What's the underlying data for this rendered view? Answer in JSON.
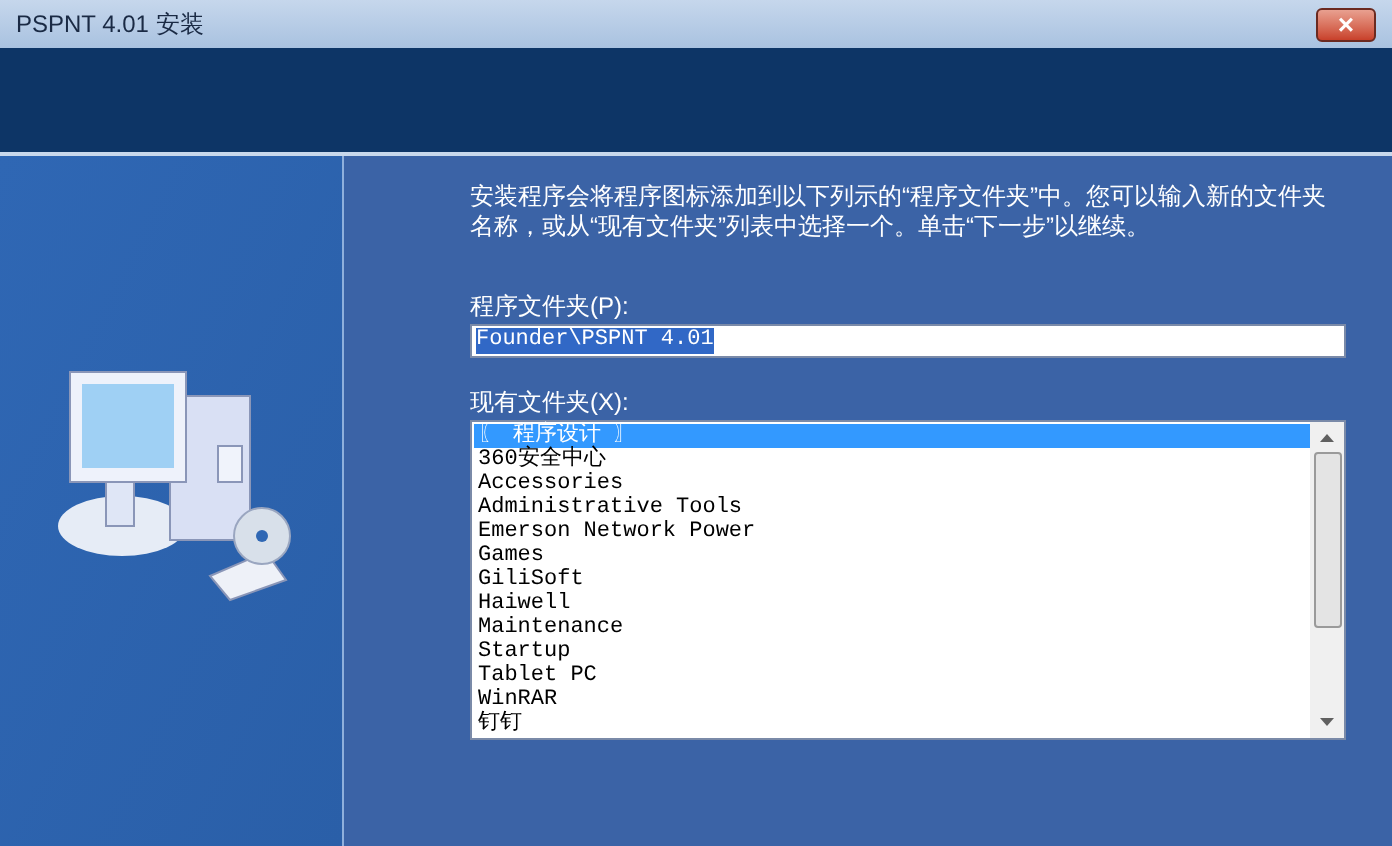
{
  "window": {
    "title": "PSPNT 4.01 安装",
    "close_label": "×"
  },
  "instructions": "安装程序会将程序图标添加到以下列示的“程序文件夹”中。您可以输入新的文件夹名称，或从“现有文件夹”列表中选择一个。单击“下一步”以继续。",
  "program_folder": {
    "label": "程序文件夹(P):",
    "value": "Founder\\PSPNT 4.01"
  },
  "existing_folders": {
    "label": "现有文件夹(X):",
    "items": [
      {
        "text": "〖 程序设计 〗",
        "selected": true
      },
      {
        "text": "360安全中心",
        "selected": false
      },
      {
        "text": "Accessories",
        "selected": false
      },
      {
        "text": "Administrative Tools",
        "selected": false
      },
      {
        "text": "Emerson Network Power",
        "selected": false
      },
      {
        "text": "Games",
        "selected": false
      },
      {
        "text": "GiliSoft",
        "selected": false
      },
      {
        "text": "Haiwell",
        "selected": false
      },
      {
        "text": "Maintenance",
        "selected": false
      },
      {
        "text": "Startup",
        "selected": false
      },
      {
        "text": "Tablet PC",
        "selected": false
      },
      {
        "text": "WinRAR",
        "selected": false
      },
      {
        "text": "钉钉",
        "selected": false
      }
    ]
  }
}
